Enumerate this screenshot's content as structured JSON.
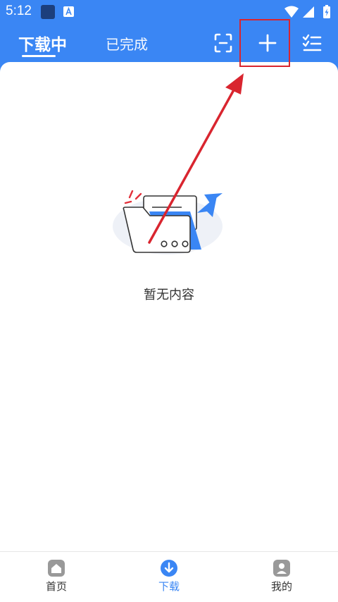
{
  "status_bar": {
    "time": "5:12"
  },
  "header": {
    "tabs": [
      {
        "label": "下载中",
        "active": true
      },
      {
        "label": "已完成",
        "active": false
      }
    ],
    "actions": [
      "scan-icon",
      "add-icon",
      "checklist-icon"
    ]
  },
  "empty_state": {
    "message": "暂无内容"
  },
  "bottom_nav": {
    "items": [
      {
        "label": "首页",
        "icon": "home-icon",
        "active": false
      },
      {
        "label": "下载",
        "icon": "download-icon",
        "active": true
      },
      {
        "label": "我的",
        "icon": "profile-icon",
        "active": false
      }
    ]
  },
  "colors": {
    "accent": "#3a86f4",
    "annotation": "#d9252f",
    "inactive": "#333333"
  }
}
